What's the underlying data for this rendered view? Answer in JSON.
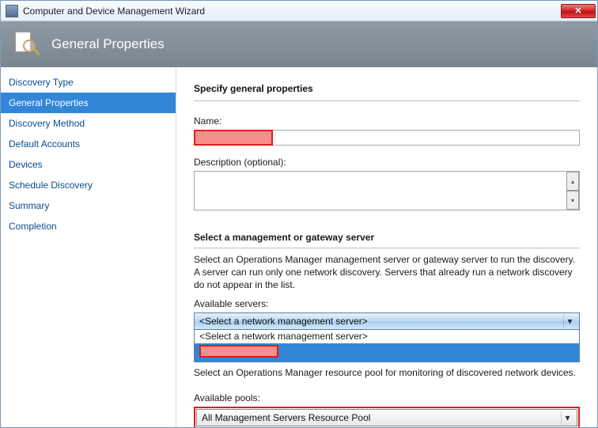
{
  "window": {
    "title": "Computer and Device Management Wizard"
  },
  "header": {
    "title": "General Properties"
  },
  "sidebar": {
    "items": [
      {
        "label": "Discovery Type",
        "active": false
      },
      {
        "label": "General Properties",
        "active": true
      },
      {
        "label": "Discovery Method",
        "active": false
      },
      {
        "label": "Default Accounts",
        "active": false
      },
      {
        "label": "Devices",
        "active": false
      },
      {
        "label": "Schedule Discovery",
        "active": false
      },
      {
        "label": "Summary",
        "active": false
      },
      {
        "label": "Completion",
        "active": false
      }
    ]
  },
  "main": {
    "section_title": "Specify general properties",
    "name_label": "Name:",
    "name_value": "",
    "description_label": "Description (optional):",
    "description_value": "",
    "mgmt_heading": "Select a management or gateway server",
    "mgmt_help": "Select an Operations Manager management server or gateway server to run the discovery. A server can run only one network discovery. Servers that already run a network discovery do not appear in the list.",
    "available_servers_label": "Available servers:",
    "servers_dropdown": {
      "selected": "<Select a network management server>",
      "option_placeholder": "<Select a network management server>",
      "option_redacted": ""
    },
    "resource_pool_help": "Select an Operations Manager resource pool for monitoring of discovered network devices.",
    "available_pools_label": "Available pools:",
    "pools_dropdown": {
      "selected": "All Management Servers Resource Pool"
    }
  }
}
